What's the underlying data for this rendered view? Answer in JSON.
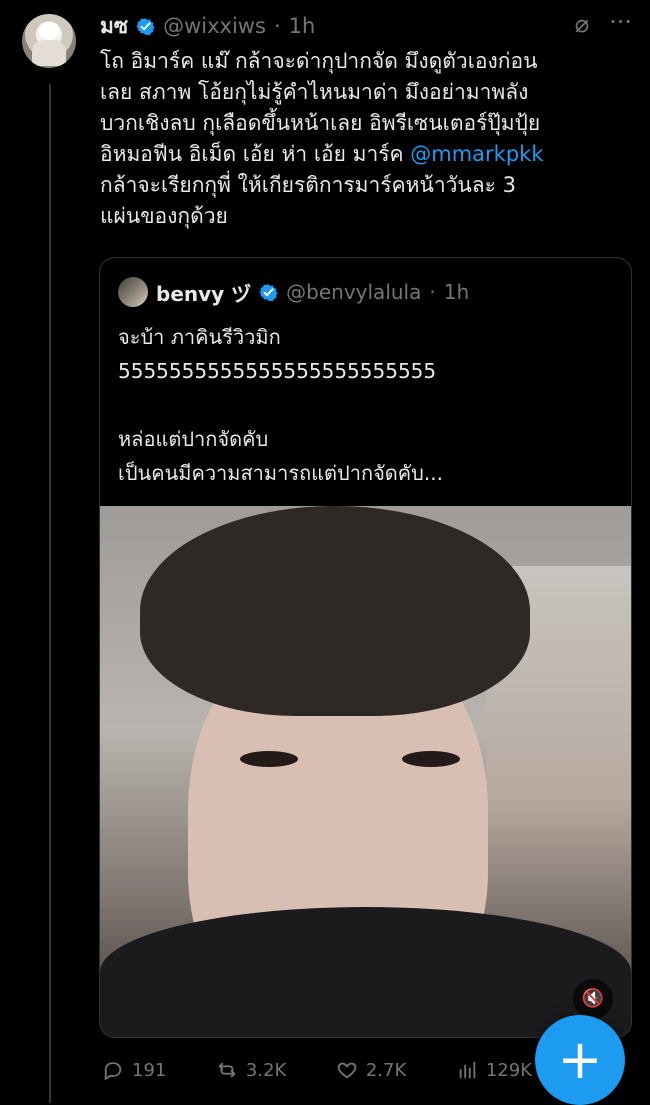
{
  "tweet": {
    "name": "มซ",
    "handle": "@wixxiws",
    "separator": "·",
    "time": "1h",
    "text_lines": [
      "โถ อิมาร์ค แม๊ กล้าจะด่ากุปากจัด มึงดูตัวเองก่อน",
      "เลย สภาพ โอ้ยกุไม่รู้คำไหนมาด่า มึงอย่ามาพลัง",
      "บวกเชิงลบ กุเลือดขึ้นหน้าเลย อิพรีเซนเตอร์ปุ๊มปุ้ย",
      "อิหมอฟีน อิเม็ด เอ้ย ห่า เอ้ย มาร์ค ",
      "กล้าจะเรียกกุพี่ ให้เกียรติการมาร์คหน้าวันละ 3",
      "แผ่นของกุด้วย"
    ],
    "mention": "@mmarkpkk"
  },
  "quote": {
    "name": "benvy ヅ",
    "handle": "@benvylalula",
    "separator": "·",
    "time": "1h",
    "text": "จะบ้า ภาคินรีวิวมิก\n5555555555555555555555555\n\nหล่อแต่ปากจัดคับ\nเป็นคนมีความสามารถแต่ปากจัดคับ..."
  },
  "actions": {
    "replies": "191",
    "reposts": "3.2K",
    "likes": "2.7K",
    "views": "129K"
  },
  "icons": {
    "verified": "verified-badge-icon",
    "grok": "grok-icon",
    "more": "more-icon",
    "mute": "mute-icon",
    "reply": "reply-icon",
    "repost": "repost-icon",
    "like": "like-icon",
    "views": "views-icon",
    "compose": "compose-icon"
  },
  "colors": {
    "accent": "#1d9bf0",
    "background": "#000000",
    "text": "#e7e9ea",
    "muted": "#71767b"
  }
}
